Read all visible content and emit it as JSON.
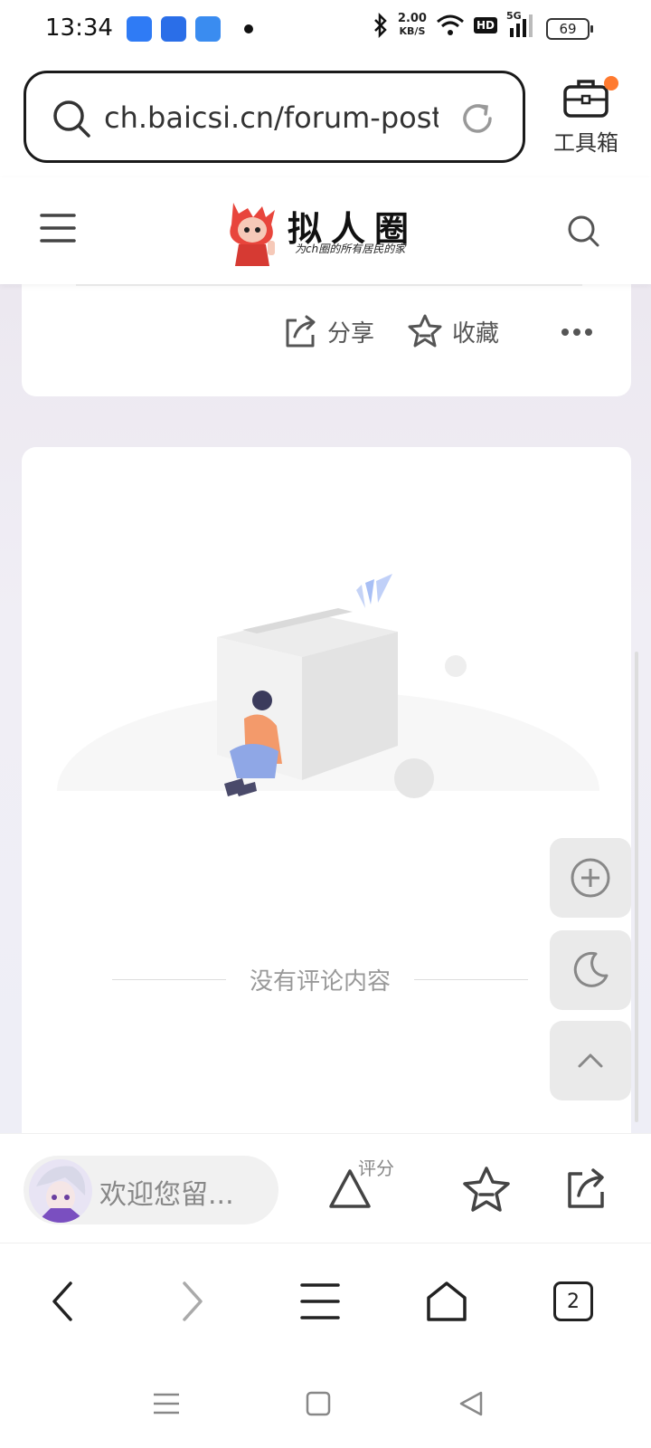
{
  "status_bar": {
    "time": "13:34",
    "net_speed_value": "2.00",
    "net_speed_unit": "KB/S",
    "hd": "HD",
    "signal": "5G",
    "battery": "69"
  },
  "browser": {
    "url": "ch.baicsi.cn/forum-post...",
    "toolbox_label": "工具箱"
  },
  "site": {
    "logo_text": "拟人圈",
    "logo_subtitle": "为ch圈的所有居民的家"
  },
  "post_actions": {
    "share_label": "分享",
    "favorite_label": "收藏"
  },
  "comments": {
    "empty_text": "没有评论内容"
  },
  "comment_bar": {
    "placeholder": "欢迎您留...",
    "rate_label": "评分"
  },
  "browser_nav": {
    "tab_count": "2"
  },
  "colors": {
    "accent_dot": "#ff7a2f",
    "background_tint": "#eeeef6"
  }
}
